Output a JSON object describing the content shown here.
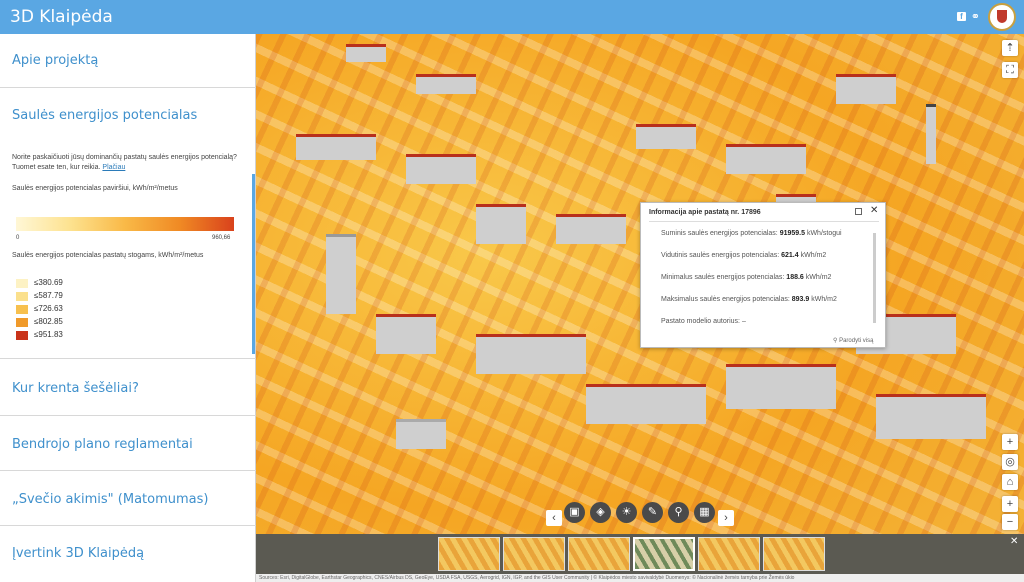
{
  "app": {
    "title": "3D Klaipėda"
  },
  "header": {
    "facebook_icon": "f",
    "link_icon": "🔗"
  },
  "sidebar": {
    "sections": [
      {
        "label": "Apie projektą"
      },
      {
        "label": "Saulės energijos potencialas"
      },
      {
        "label": "Kur krenta šešėliai?"
      },
      {
        "label": "Bendrojo plano reglamentai"
      },
      {
        "label": "„Svečio akimis\" (Matomumas)"
      },
      {
        "label": "Įvertink 3D Klaipėdą"
      }
    ],
    "panel": {
      "intro": "Norite paskaičiuoti jūsų dominančių pastatų saulės energijos potencialą? Tuomet esate ten, kur reikia.",
      "intro_link": "Plačiau",
      "surface_label": "Saulės energijos potencialas paviršiui, kWh/m²/metus",
      "gradient_min": "0",
      "gradient_max": "960,66",
      "roof_label": "Saulės energijos potencialas pastatų stogams, kWh/m²/metus",
      "legend": [
        {
          "label": "≤380.69",
          "color": "#fdf2c4"
        },
        {
          "label": "≤587.79",
          "color": "#fbe08c"
        },
        {
          "label": "≤726.63",
          "color": "#f7c04e"
        },
        {
          "label": "≤802.85",
          "color": "#f09a2a"
        },
        {
          "label": "≤951.83",
          "color": "#c9331a"
        }
      ]
    }
  },
  "popup": {
    "title": "Informacija apie pastatą nr. 17896",
    "rows": [
      {
        "label": "Suminis saulės energijos potencialas:",
        "value": "91959.5",
        "unit": "kWh/stogui"
      },
      {
        "label": "Vidutinis saulės energijos potencialas:",
        "value": "621.4",
        "unit": "kWh/m2"
      },
      {
        "label": "Minimalus saulės energijos potencialas:",
        "value": "188.6",
        "unit": "kWh/m2"
      },
      {
        "label": "Maksimalus saulės energijos potencialas:",
        "value": "893.9",
        "unit": "kWh/m2"
      },
      {
        "label": "Pastato modelio autorius:",
        "value": "",
        "unit": "–"
      }
    ],
    "zoom_label": "Parodyti visą"
  },
  "toolbar": {
    "buttons": [
      {
        "name": "basemap-icon",
        "glyph": "▣"
      },
      {
        "name": "layers-icon",
        "glyph": "◈"
      },
      {
        "name": "sun-icon",
        "glyph": "☀"
      },
      {
        "name": "measure-icon",
        "glyph": "✎"
      },
      {
        "name": "search-icon",
        "glyph": "⚲"
      },
      {
        "name": "grid-icon",
        "glyph": "▦"
      }
    ],
    "prev": "‹",
    "next": "›"
  },
  "thumbnails": {
    "count": 6,
    "selected": 4,
    "close": "✕"
  },
  "credits": "Sources: Esri, DigitalGlobe, Earthstar Geographics, CNES/Airbus DS, GeoEye, USDA FSA, USGS, Aerogrid, IGN, IGP, and the GIS User Community | © Klaipėdos miesto savivaldybė Duomenys: © Nacionalinė žemės tarnyba prie Žemės ūkio",
  "map_controls": {
    "plus": "+",
    "minus": "−"
  }
}
